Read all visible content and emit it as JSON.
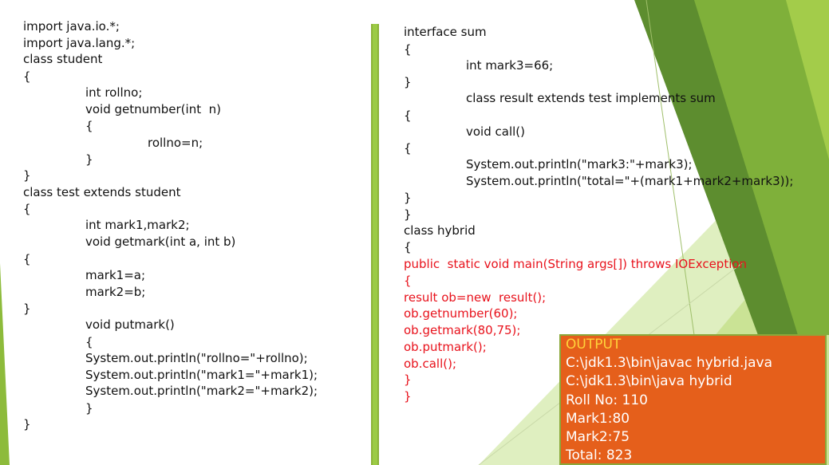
{
  "left_code": [
    "import java.io.*;",
    "import java.lang.*;",
    "class student",
    "{",
    "int rollno;",
    "void getnumber(int  n)",
    "{",
    "rollno=n;",
    "}",
    "}",
    "class test extends student",
    "{",
    "int mark1,mark2;",
    "void getmark(int a, int b)",
    "{",
    "mark1=a;",
    "mark2=b;",
    "}",
    "void putmark()",
    "{",
    "System.out.println(\"rollno=\"+rollno);",
    "System.out.println(\"mark1=\"+mark1);",
    "System.out.println(\"mark2=\"+mark2);",
    "}",
    "}"
  ],
  "right_code": [
    "interface sum",
    "{",
    "int mark3=66;",
    "}",
    "class result extends test implements sum",
    "{",
    "void call()",
    "{",
    "System.out.println(\"mark3:\"+mark3);",
    "System.out.println(\"total=\"+(mark1+mark2+mark3));",
    "}",
    "}",
    "class hybrid",
    "{",
    "public  static void main(String args[]) throws IOException",
    "{",
    "result ob=new  result();",
    "ob.getnumber(60);",
    "ob.getmark(80,75);",
    "ob.putmark();",
    "ob.call();",
    "}",
    "}"
  ],
  "output": {
    "title": "OUTPUT",
    "lines": [
      "C:\\jdk1.3\\bin\\javac hybrid.java",
      "C:\\jdk1.3\\bin\\java hybrid",
      "Roll No: 110",
      "Mark1:80",
      "Mark2:75",
      "Total: 823"
    ]
  },
  "colors": {
    "code_text": "#111111",
    "highlight_red": "#e8121c",
    "output_bg": "#e55f1b",
    "output_title": "#ffd23a",
    "divider": "#8db33a"
  }
}
